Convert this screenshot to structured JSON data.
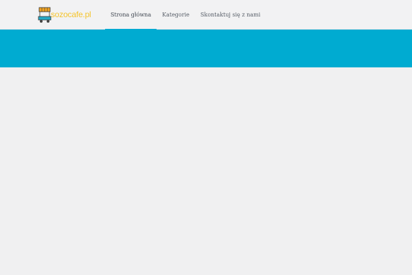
{
  "site": {
    "logo_text": "sozocafe.pl",
    "logo_icon": "food-cart-icon"
  },
  "nav": {
    "items": [
      {
        "label": "Strona główna",
        "active": true
      },
      {
        "label": "Kategorie",
        "active": false
      },
      {
        "label": "Skontaktuj się z nami",
        "active": false
      }
    ]
  },
  "colors": {
    "accent": "#00abd1",
    "logo_text": "#f5c42c",
    "background": "#f0f0f1"
  }
}
